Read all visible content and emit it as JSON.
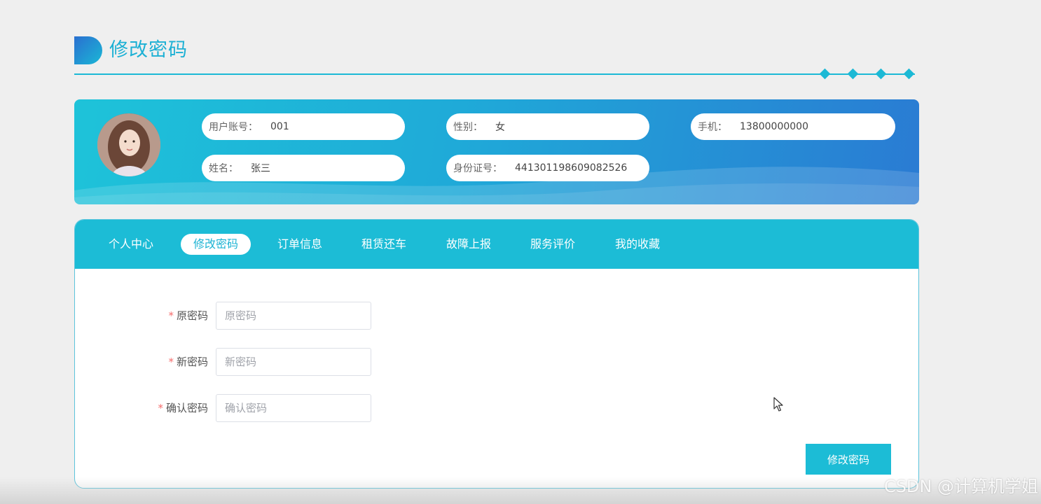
{
  "page": {
    "title": "修改密码"
  },
  "profile": {
    "fields": [
      {
        "label": "用户账号：",
        "value": "001"
      },
      {
        "label": "性别：",
        "value": "女"
      },
      {
        "label": "手机：",
        "value": "13800000000"
      },
      {
        "label": "姓名：",
        "value": "张三"
      },
      {
        "label": "身份证号：",
        "value": "441301198609082526"
      }
    ]
  },
  "tabs": [
    {
      "label": "个人中心",
      "active": false
    },
    {
      "label": "修改密码",
      "active": true
    },
    {
      "label": "订单信息",
      "active": false
    },
    {
      "label": "租赁还车",
      "active": false
    },
    {
      "label": "故障上报",
      "active": false
    },
    {
      "label": "服务评价",
      "active": false
    },
    {
      "label": "我的收藏",
      "active": false
    }
  ],
  "form": {
    "required_mark": "*",
    "fields": [
      {
        "label": "原密码",
        "placeholder": "原密码",
        "value": ""
      },
      {
        "label": "新密码",
        "placeholder": "新密码",
        "value": ""
      },
      {
        "label": "确认密码",
        "placeholder": "确认密码",
        "value": ""
      }
    ],
    "submit_label": "修改密码"
  },
  "watermark": "CSDN @计算机学姐",
  "colors": {
    "accent": "#1cbcd6",
    "banner_start": "#1ec3d9",
    "banner_end": "#2a7bd3",
    "required": "#f56c6c"
  }
}
